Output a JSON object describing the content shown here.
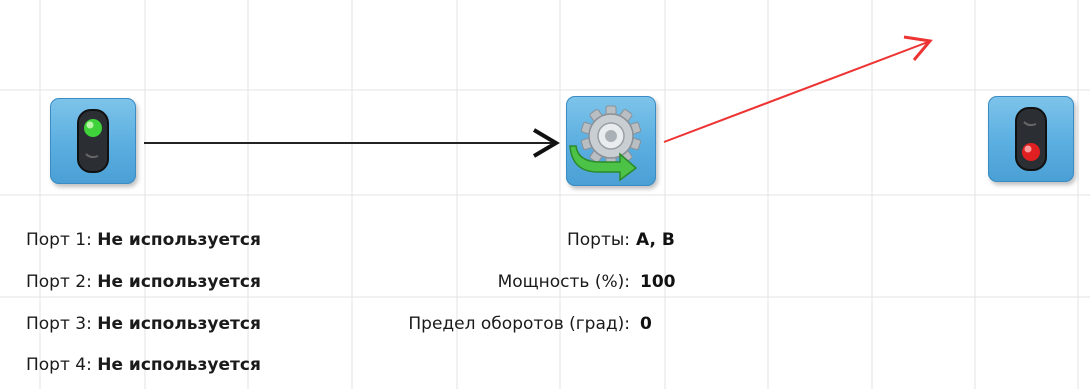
{
  "start_block": {
    "icon": "traffic-light-green-icon"
  },
  "motor_block": {
    "icon": "gear-rotation-icon"
  },
  "end_block": {
    "icon": "traffic-light-red-icon"
  },
  "start_params": [
    {
      "label": "Порт 1:",
      "value": "Не используется"
    },
    {
      "label": "Порт 2:",
      "value": "Не используется"
    },
    {
      "label": "Порт 3:",
      "value": "Не используется"
    },
    {
      "label": "Порт 4:",
      "value": "Не используется"
    }
  ],
  "motor_params": [
    {
      "label": "Порты:",
      "value": "A, B"
    },
    {
      "label": "Мощность (%):",
      "value": "100"
    },
    {
      "label": "Предел оборотов (град):",
      "value": "0"
    }
  ],
  "colors": {
    "grid": "#e3e3e3",
    "block_fill": "#5aaee0",
    "connector": "#222222",
    "pending_connector": "#ee3333"
  }
}
